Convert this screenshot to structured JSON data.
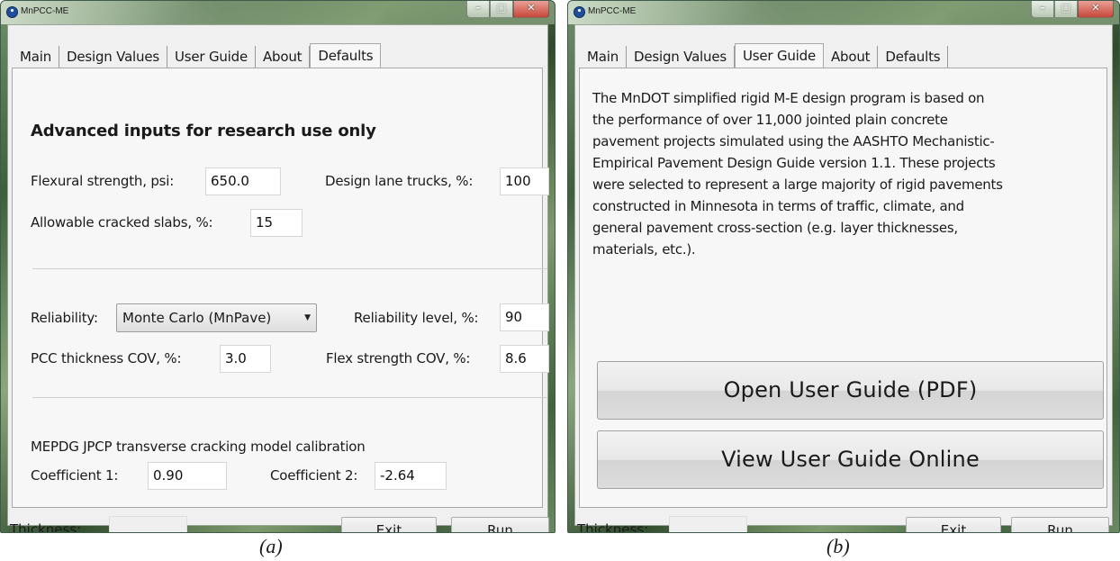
{
  "left": {
    "title": "MnPCC-ME",
    "tabs": [
      "Main",
      "Design Values",
      "User Guide",
      "About",
      "Defaults"
    ],
    "heading": "Advanced inputs for research use only",
    "flexural_label": "Flexural strength, psi:",
    "flexural_value": "650.0",
    "lane_trucks_label": "Design lane trucks, %:",
    "lane_trucks_value": "100",
    "cracked_label": "Allowable cracked slabs, %:",
    "cracked_value": "15",
    "reliability_label": "Reliability:",
    "reliability_selected": "Monte Carlo (MnPave)",
    "reliability_level_label": "Reliability level, %:",
    "reliability_level_value": "90",
    "pcc_cov_label": "PCC thickness COV, %:",
    "pcc_cov_value": "3.0",
    "flex_cov_label": "Flex strength COV, %:",
    "flex_cov_value": "8.6",
    "calibration_title": "MEPDG JPCP transverse cracking model calibration",
    "coef1_label": "Coefficient 1:",
    "coef1_value": "0.90",
    "coef2_label": "Coefficient 2:",
    "coef2_value": "-2.64",
    "thickness_label": "Thickness:",
    "exit_label": "Exit",
    "run_label": "Run",
    "caption": "(a)"
  },
  "right": {
    "title": "MnPCC-ME",
    "tabs": [
      "Main",
      "Design Values",
      "User Guide",
      "About",
      "Defaults"
    ],
    "guide_lines": [
      "The MnDOT simplified rigid M-E design program is based on",
      "the performance of over 11,000 jointed plain concrete",
      "pavement projects simulated using the AASHTO Mechanistic-",
      "Empirical Pavement Design Guide version 1.1.  These projects",
      "were selected to represent a large majority of rigid pavements",
      "constructed in Minnesota in terms of traffic, climate, and",
      "general pavement cross-section (e.g. layer thicknesses,",
      "materials, etc.)."
    ],
    "open_pdf_label": "Open User Guide (PDF)",
    "view_online_label": "View User Guide Online",
    "thickness_label": "Thickness:",
    "exit_label": "Exit",
    "run_label": "Run",
    "caption": "(b)"
  }
}
